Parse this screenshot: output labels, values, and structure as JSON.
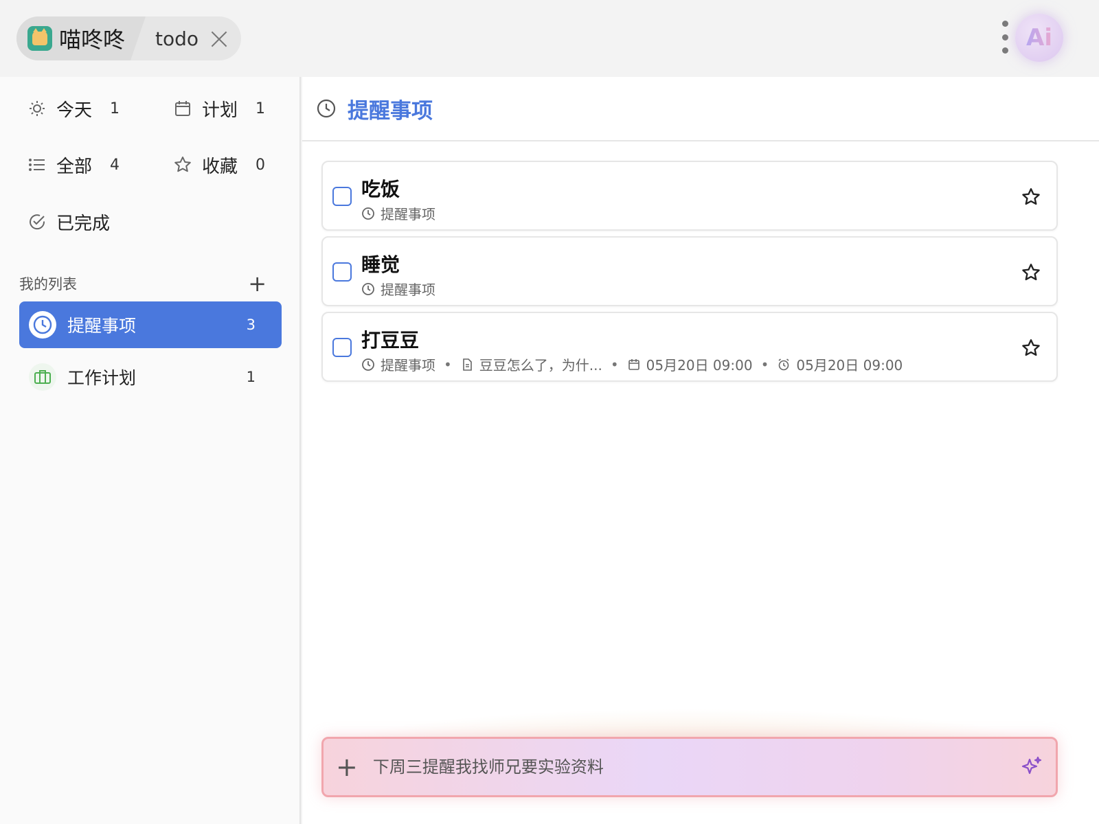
{
  "titlebar": {
    "app_name": "喵咚咚",
    "tab_name": "todo"
  },
  "sidebar": {
    "smart_lists": [
      {
        "label": "今天",
        "count": "1",
        "icon": "sun-icon"
      },
      {
        "label": "计划",
        "count": "1",
        "icon": "calendar-icon"
      },
      {
        "label": "全部",
        "count": "4",
        "icon": "list-icon"
      },
      {
        "label": "收藏",
        "count": "0",
        "icon": "star-icon"
      },
      {
        "label": "已完成",
        "count": "",
        "icon": "check-circle-icon"
      }
    ],
    "my_lists_title": "我的列表",
    "lists": [
      {
        "name": "提醒事项",
        "count": "3",
        "icon": "clock-icon",
        "active": true
      },
      {
        "name": "工作计划",
        "count": "1",
        "icon": "briefcase-icon",
        "active": false
      }
    ]
  },
  "main": {
    "title": "提醒事项",
    "tasks": [
      {
        "title": "吃饭",
        "list": "提醒事项"
      },
      {
        "title": "睡觉",
        "list": "提醒事项"
      },
      {
        "title": "打豆豆",
        "list": "提醒事项",
        "note": "豆豆怎么了，为什...",
        "due": "05月20日 09:00",
        "alarm": "05月20日 09:00"
      }
    ]
  },
  "input": {
    "placeholder": "下周三提醒我找师兄要实验资料"
  },
  "colors": {
    "accent": "#4a78dd",
    "work_list": "#4caf50"
  }
}
